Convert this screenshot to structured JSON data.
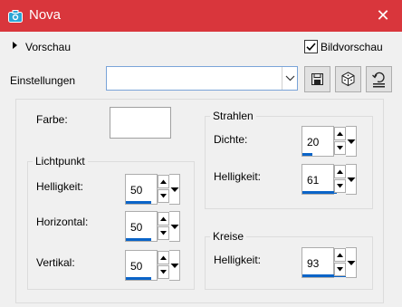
{
  "window": {
    "title": "Nova",
    "close_icon": "close-icon",
    "app_icon": "camera-icon"
  },
  "header": {
    "preview_toggle_label": "Vorschau",
    "bild_preview_label": "Bildvorschau",
    "bild_preview_checked": true
  },
  "settings": {
    "label": "Einstellungen",
    "selected_value": "",
    "buttons": [
      "save-icon",
      "randomize-cube-icon",
      "reset-icon"
    ]
  },
  "color": {
    "label": "Farbe:",
    "value": "#ffffff"
  },
  "lichtpunkt": {
    "title": "Lichtpunkt",
    "helligkeit": {
      "label": "Helligkeit:",
      "value": "50",
      "level": 0.5
    },
    "horizontal": {
      "label": "Horizontal:",
      "value": "50",
      "level": 0.5
    },
    "vertikal": {
      "label": "Vertikal:",
      "value": "50",
      "level": 0.5
    }
  },
  "strahlen": {
    "title": "Strahlen",
    "dichte": {
      "label": "Dichte:",
      "value": "20",
      "level": 0.2
    },
    "helligkeit": {
      "label": "Helligkeit:",
      "value": "61",
      "level": 0.61
    }
  },
  "kreise": {
    "title": "Kreise",
    "helligkeit": {
      "label": "Helligkeit:",
      "value": "93",
      "level": 0.93
    }
  },
  "colors": {
    "titlebar": "#d9363c",
    "accent": "#0a64c8"
  }
}
